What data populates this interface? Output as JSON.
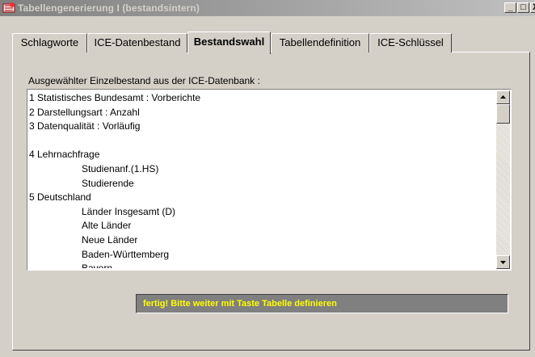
{
  "window": {
    "title": "Tabellengenerierung I (bestandsintern)",
    "buttons": {
      "minimize": "_",
      "maximize": "□",
      "close": "X"
    }
  },
  "tabs": [
    {
      "label": "Schlagworte",
      "active": false
    },
    {
      "label": "ICE-Datenbestand",
      "active": false
    },
    {
      "label": "Bestandswahl",
      "active": true
    },
    {
      "label": "Tabellendefinition",
      "active": false
    },
    {
      "label": "ICE-Schlüssel",
      "active": false
    }
  ],
  "list": {
    "caption": "Ausgewählter Einzelbestand aus der ICE-Datenbank :",
    "lines": [
      {
        "text": "1  Statistisches Bundesamt :  Vorberichte",
        "level": 0
      },
      {
        "text": "2  Darstellungsart :  Anzahl",
        "level": 0
      },
      {
        "text": "3  Datenqualität :  Vorläufig",
        "level": 0
      },
      {
        "text": "",
        "level": 0
      },
      {
        "text": "4  Lehrnachfrage",
        "level": 0
      },
      {
        "text": "Studienanf.(1.HS)",
        "level": 1
      },
      {
        "text": "Studierende",
        "level": 1
      },
      {
        "text": "5  Deutschland",
        "level": 0
      },
      {
        "text": "Länder Insgesamt (D)",
        "level": 1
      },
      {
        "text": "Alte Länder",
        "level": 1
      },
      {
        "text": "Neue Länder",
        "level": 1
      },
      {
        "text": "Baden-Württemberg",
        "level": 1
      },
      {
        "text": "Bayern",
        "level": 1
      }
    ]
  },
  "status": {
    "message": "fertig! Bitte weiter mit Taste Tabelle definieren",
    "text_color": "#ffff00",
    "background_color": "#808080"
  },
  "icons": {
    "app": "app-icon",
    "scroll_up": "arrow-up-icon",
    "scroll_down": "arrow-down-icon"
  }
}
